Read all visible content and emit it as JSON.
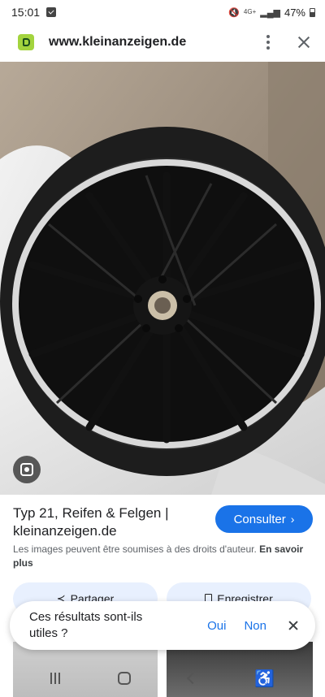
{
  "status_bar": {
    "time": "15:01",
    "network_label": "4G+",
    "battery_percent": "47%",
    "icons": [
      "notification-icon",
      "mute-icon",
      "wifi-icon",
      "signal-icon",
      "battery-icon"
    ]
  },
  "browser": {
    "url": "www.kleinanzeigen.de",
    "favicon": "kleinanzeigen-favicon"
  },
  "result": {
    "title_line1": "Typ 21, Reifen & Felgen |",
    "title_line2": "kleinanzeigen.de",
    "visit_label": "Consulter",
    "copyright_text": "Les images peuvent être soumises à des droits d'auteur.",
    "learn_more_label": "En savoir plus",
    "share_label": "Partager",
    "save_label": "Enregistrer"
  },
  "feedback": {
    "question": "Ces résultats sont-ils utiles ?",
    "yes_label": "Oui",
    "no_label": "Non"
  },
  "colors": {
    "accent": "#1a73e8",
    "chip_bg": "#e8f0fe",
    "favicon": "#a3d43e"
  }
}
